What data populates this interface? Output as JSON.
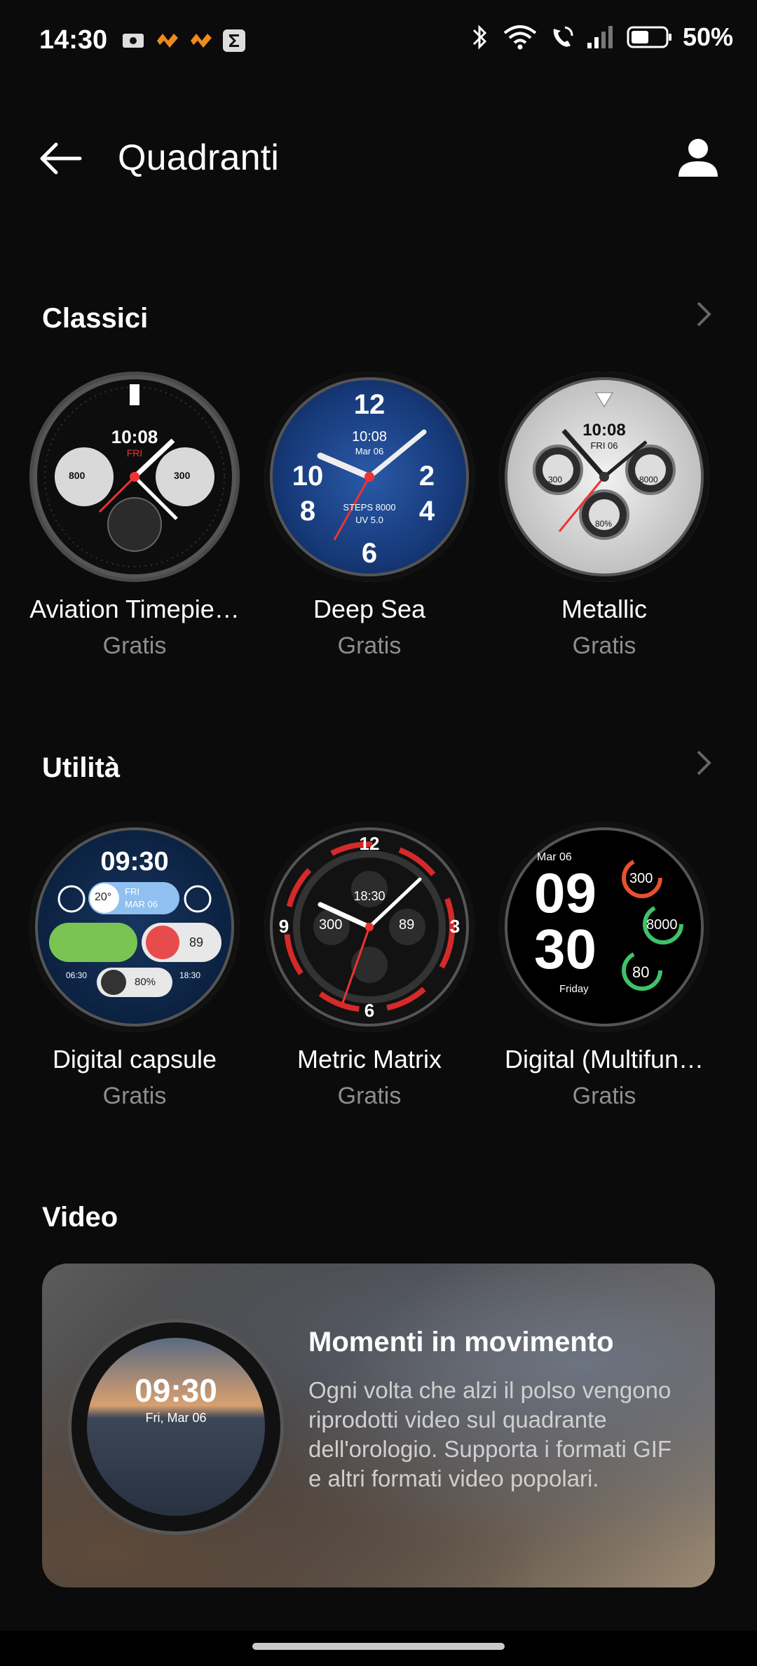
{
  "status": {
    "time": "14:30",
    "battery": "50%"
  },
  "header": {
    "title": "Quadranti"
  },
  "sections": {
    "classici": {
      "title": "Classici",
      "items": [
        {
          "name": "Aviation Timepie…",
          "price": "Gratis",
          "time": "10:08",
          "day": "FRI",
          "left": "800",
          "right": "300"
        },
        {
          "name": "Deep Sea",
          "price": "Gratis",
          "time": "10:08",
          "date": "Mar 06",
          "steps": "STEPS 8000",
          "uv": "UV 5.0"
        },
        {
          "name": "Metallic",
          "price": "Gratis",
          "time": "10:08",
          "date": "FRI 06",
          "kcal": "300",
          "step": "8000",
          "bat": "80%"
        }
      ]
    },
    "utilita": {
      "title": "Utilità",
      "items": [
        {
          "name": "Digital capsule",
          "price": "Gratis",
          "time": "09:30",
          "temp": "20°",
          "day": "FRI",
          "date": "MAR 06",
          "heart": "89",
          "battery": "80%",
          "sunrise": "06:30",
          "sunset": "18:30"
        },
        {
          "name": "Metric Matrix",
          "price": "Gratis",
          "time": "18:30",
          "kcal": "300",
          "heart": "89"
        },
        {
          "name": "Digital (Multifun…",
          "price": "Gratis",
          "date": "Mar 06",
          "hour": "09",
          "minute": "30",
          "weekday": "Friday",
          "kcal": "300",
          "steps": "8000",
          "heart": "80"
        }
      ]
    },
    "video": {
      "title": "Video",
      "card_title": "Momenti in movimento",
      "card_desc": "Ogni volta che alzi il polso vengono riprodotti video sul quadrante dell'orologio. Supporta i formati GIF e altri formati video popolari.",
      "face_time": "09:30",
      "face_date": "Fri, Mar 06"
    }
  }
}
